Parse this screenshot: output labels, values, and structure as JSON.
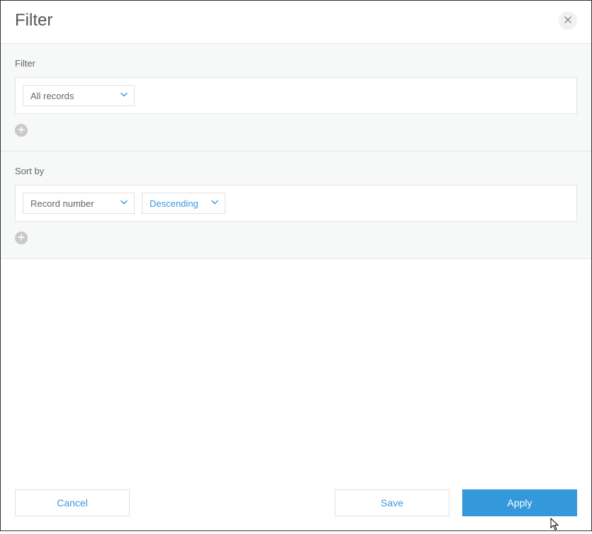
{
  "dialog": {
    "title": "Filter"
  },
  "filter_section": {
    "label": "Filter",
    "field_select": {
      "value": "All records"
    }
  },
  "sort_section": {
    "label": "Sort by",
    "field_select": {
      "value": "Record number"
    },
    "direction_select": {
      "value": "Descending"
    }
  },
  "footer": {
    "cancel": "Cancel",
    "save": "Save",
    "apply": "Apply"
  },
  "colors": {
    "accent": "#3498db",
    "link": "#3b99e0",
    "border": "#e5e5e5",
    "panel_bg": "#f7f8f8"
  }
}
